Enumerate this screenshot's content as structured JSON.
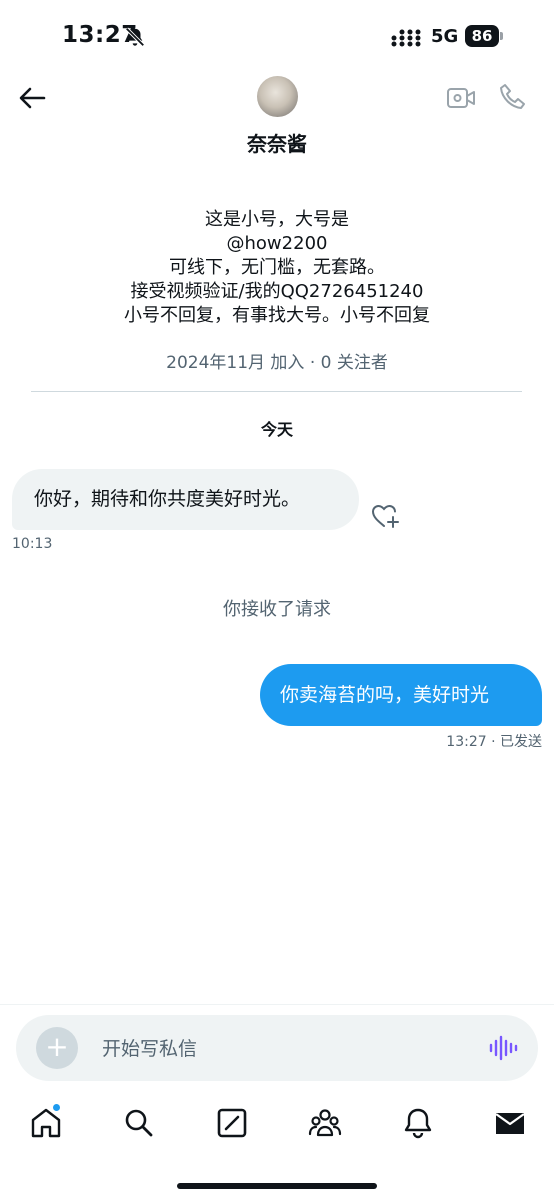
{
  "status_bar": {
    "time": "13:27",
    "network": "5G",
    "battery": "86"
  },
  "header": {
    "contact_name": "奈奈酱"
  },
  "bio": {
    "lines": [
      "这是小号，大号是",
      "@how2200",
      "可线下，无门槛，无套路。",
      "接受视频验证/我的QQ2726451240",
      "小号不回复，有事找大号。小号不回复"
    ],
    "joined": "2024年11月 加入 · 0 关注者"
  },
  "conversation": {
    "date_separator": "今天",
    "messages": [
      {
        "direction": "incoming",
        "text": "你好，期待和你共度美好时光。",
        "meta": "10:13"
      },
      {
        "direction": "system",
        "text": "你接收了请求"
      },
      {
        "direction": "outgoing",
        "text": "你卖海苔的吗，美好时光",
        "meta": "13:27 · 已发送"
      }
    ]
  },
  "composer": {
    "placeholder": "开始写私信"
  },
  "bottom_nav": {
    "items": [
      "home-icon",
      "search-icon",
      "grok-icon",
      "communities-icon",
      "notifications-icon",
      "messages-icon"
    ],
    "active": "messages-icon"
  },
  "colors": {
    "accent": "#1d9bf0",
    "voice": "#7856ff",
    "muted_text": "#536471",
    "bubble_in": "#eff3f4"
  }
}
